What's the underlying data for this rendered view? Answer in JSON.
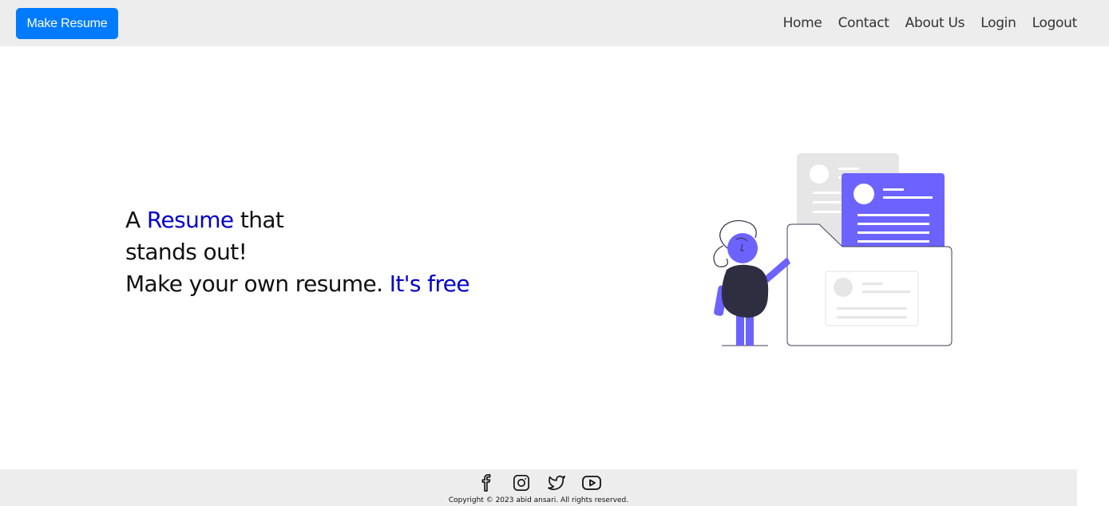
{
  "navbar": {
    "brand_button": "Make Resume",
    "links": [
      "Home",
      "Contact",
      "About Us",
      "Login",
      "Logout"
    ]
  },
  "hero": {
    "line1_pre": "A ",
    "line1_highlight": "Resume",
    "line1_post": " that",
    "line2": "stands out!",
    "line3_pre": "Make your own resume. ",
    "line3_highlight": "It's free"
  },
  "footer": {
    "social_icons": [
      "facebook-icon",
      "instagram-icon",
      "twitter-icon",
      "youtube-icon"
    ],
    "copyright": "Copyright © 2023 abid ansari. All rights reserved."
  },
  "colors": {
    "brand_button": "#007bff",
    "highlight": "#0000cc",
    "navbar_bg": "#ededed",
    "illustration_accent": "#6c63ff"
  }
}
